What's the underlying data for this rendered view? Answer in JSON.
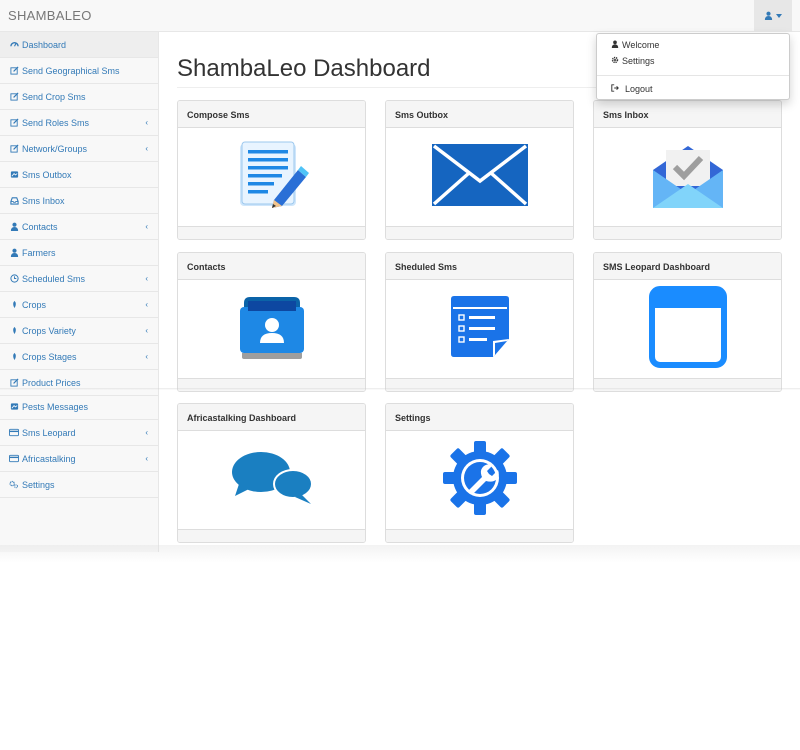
{
  "navbar": {
    "brand": "SHAMBALEO"
  },
  "user_menu": {
    "items": [
      {
        "label": "Welcome",
        "icon": "user-icon"
      },
      {
        "label": "Settings",
        "icon": "gear-icon"
      },
      {
        "label": "Logout",
        "icon": "logout-icon"
      }
    ]
  },
  "sidebar": {
    "items": [
      {
        "label": "Dashboard",
        "icon": "dashboard-icon"
      },
      {
        "label": "Send Geographical Sms",
        "icon": "edit-icon"
      },
      {
        "label": "Send Crop Sms",
        "icon": "edit-icon"
      },
      {
        "label": "Send Roles Sms",
        "icon": "edit-icon"
      },
      {
        "label": "Network/Groups",
        "icon": "edit-icon"
      },
      {
        "label": "Sms Outbox",
        "icon": "image-icon"
      },
      {
        "label": "Sms Inbox",
        "icon": "inbox-icon"
      },
      {
        "label": "Contacts",
        "icon": "users-icon"
      },
      {
        "label": "Farmers",
        "icon": "user-icon"
      },
      {
        "label": "Scheduled Sms",
        "icon": "clock-icon"
      },
      {
        "label": "Crops",
        "icon": "leaf-icon"
      },
      {
        "label": "Crops Variety",
        "icon": "leaf-icon"
      },
      {
        "label": "Crops Stages",
        "icon": "leaf-icon"
      },
      {
        "label": "Product Prices",
        "icon": "edit-icon"
      },
      {
        "label": "Pests Messages",
        "icon": "image-icon"
      },
      {
        "label": "Sms Leopard",
        "icon": "card-icon"
      },
      {
        "label": "Africastalking",
        "icon": "card-icon"
      },
      {
        "label": "Settings",
        "icon": "gears-icon"
      }
    ],
    "arrow": "‹"
  },
  "main": {
    "title": "ShambaLeo Dashboard",
    "panels": [
      {
        "title": "Compose Sms",
        "icon": "compose-icon"
      },
      {
        "title": "Sms Outbox",
        "icon": "envelope-icon"
      },
      {
        "title": "Sms Inbox",
        "icon": "inbox-tray-icon"
      },
      {
        "title": "Contacts",
        "icon": "contacts-icon"
      },
      {
        "title": "Sheduled Sms",
        "icon": "checklist-icon"
      },
      {
        "title": "SMS Leopard Dashboard",
        "icon": "browser-window-icon"
      },
      {
        "title": "Africastalking Dashboard",
        "icon": "chat-bubbles-icon"
      },
      {
        "title": "Settings",
        "icon": "wrench-gear-icon"
      }
    ]
  },
  "colors": {
    "link": "#337ab7",
    "accent_blue": "#1a73e8",
    "navbar_bg": "#f8f8f8"
  }
}
